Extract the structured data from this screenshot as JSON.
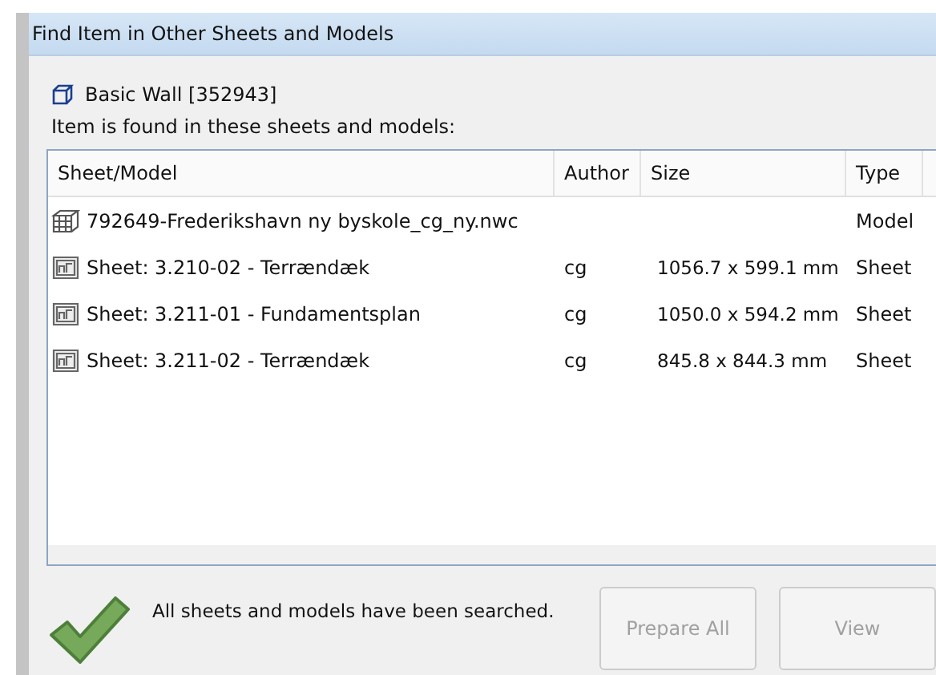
{
  "window": {
    "title": "Find Item in Other Sheets and Models"
  },
  "item": {
    "name": "Basic Wall [352943]"
  },
  "found_label": "Item is found in these sheets and models:",
  "table": {
    "columns": [
      "Sheet/Model",
      "Author",
      "Size",
      "Type"
    ],
    "rows": [
      {
        "kind": "model",
        "name": "792649-Frederikshavn ny byskole_cg_ny.nwc",
        "author": "",
        "size": "",
        "type": "Model"
      },
      {
        "kind": "sheet",
        "name": "Sheet: 3.210-02 - Terrændæk",
        "author": "cg",
        "size": "1056.7 x 599.1 mm",
        "type": "Sheet"
      },
      {
        "kind": "sheet",
        "name": "Sheet: 3.211-01 - Fundamentsplan",
        "author": "cg",
        "size": "1050.0 x 594.2 mm",
        "type": "Sheet"
      },
      {
        "kind": "sheet",
        "name": "Sheet: 3.211-02 - Terrændæk",
        "author": "cg",
        "size": "845.8 x 844.3 mm",
        "type": "Sheet"
      }
    ]
  },
  "status": {
    "text": "All sheets and models have been searched."
  },
  "buttons": [
    {
      "label": "Prepare All",
      "disabled": true
    },
    {
      "label": "View",
      "disabled": true
    }
  ]
}
